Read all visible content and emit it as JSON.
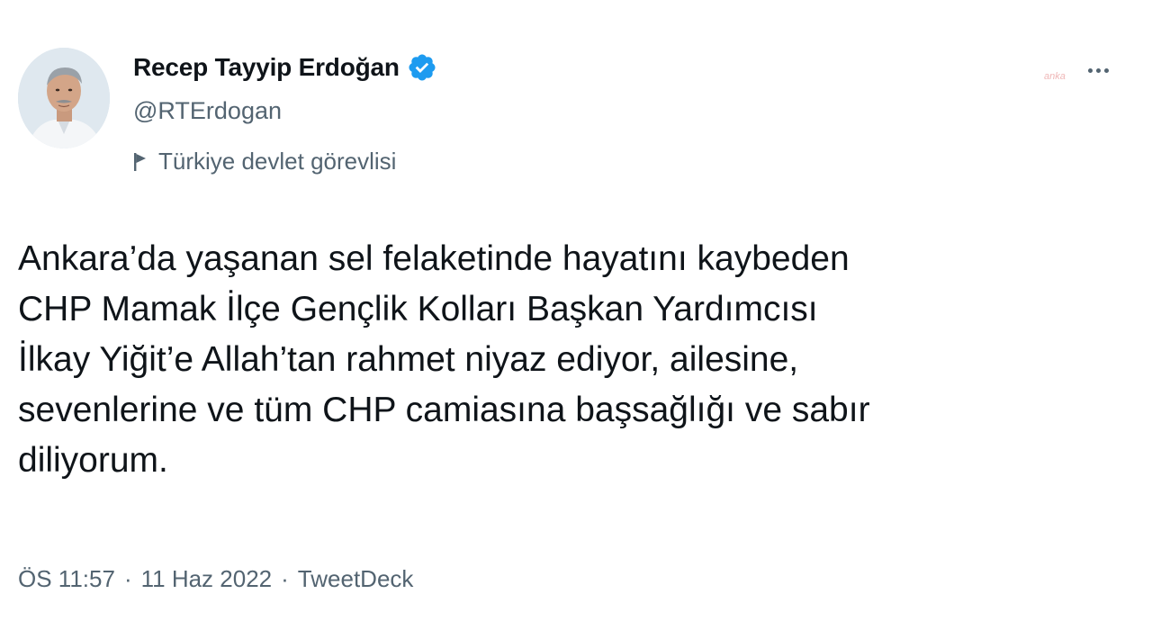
{
  "author": {
    "display_name": "Recep Tayyip Erdoğan",
    "handle": "@RTErdogan",
    "label": "Türkiye devlet görevlisi"
  },
  "tweet": {
    "lines": [
      "Ankara’da yaşanan sel felaketinde hayatını kaybeden",
      "CHP Mamak İlçe Gençlik Kolları Başkan Yardımcısı",
      "İlkay Yiğit’e Allah’tan rahmet niyaz ediyor, ailesine,",
      "sevenlerine ve tüm CHP camiasına başsağlığı ve sabır",
      "diliyorum."
    ]
  },
  "meta": {
    "time": "ÖS 11:57",
    "separator1": "·",
    "date": "11 Haz 2022",
    "separator2": "·",
    "source": "TweetDeck"
  },
  "watermark": "anka",
  "icons": {
    "verified": "verified-badge-icon",
    "label": "flag-icon",
    "menu": "more-options-icon"
  },
  "colors": {
    "verified_blue": "#1d9bf0",
    "secondary_text": "#536471",
    "primary_text": "#0f1419"
  }
}
